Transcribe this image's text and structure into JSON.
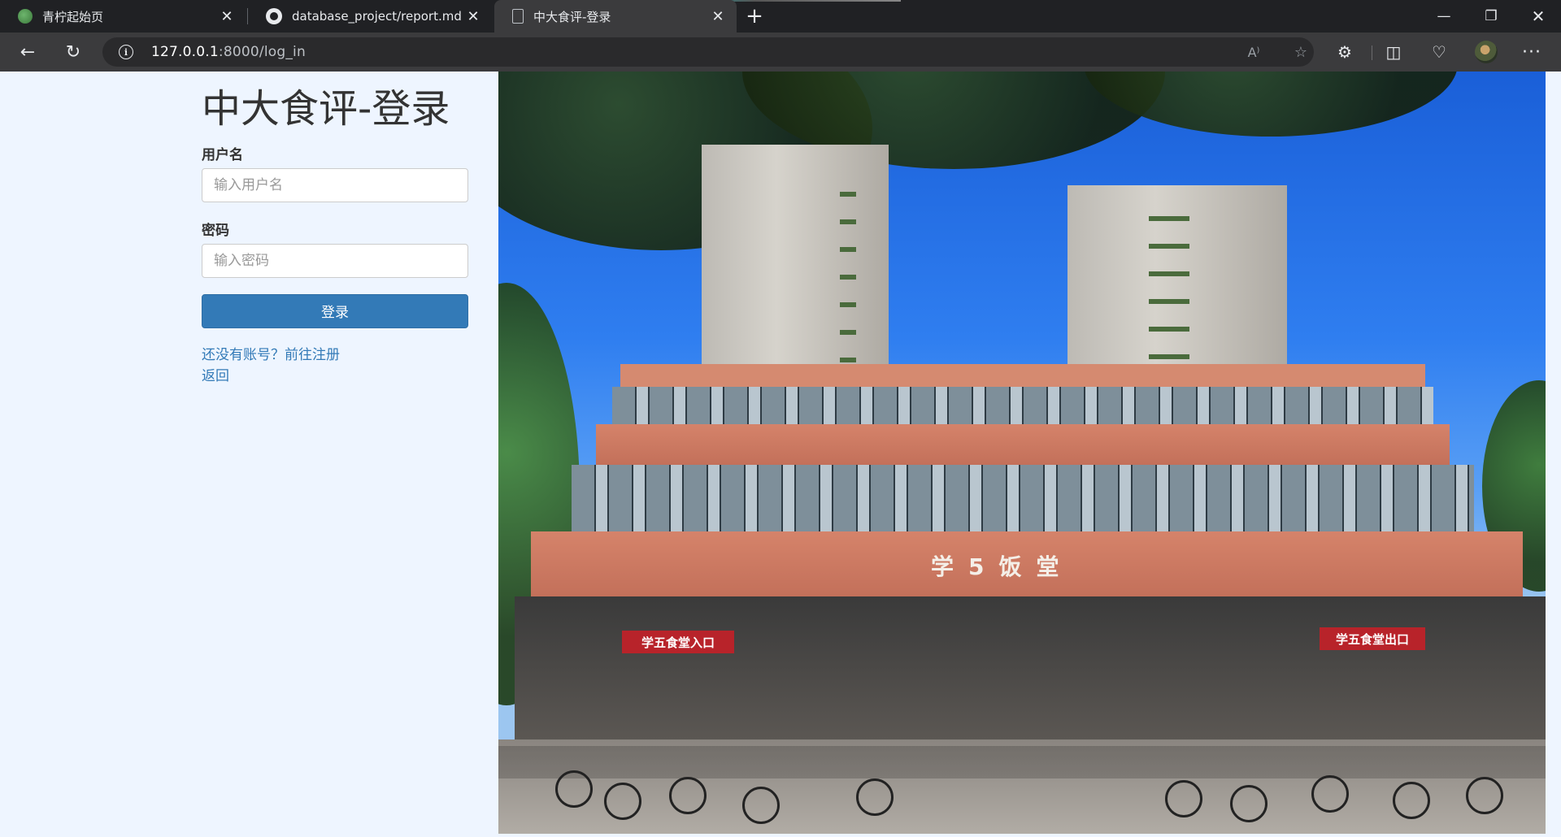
{
  "browser": {
    "tabs": [
      {
        "title": "青柠起始页",
        "icon": "leaf-icon"
      },
      {
        "title": "database_project/report.md at m",
        "icon": "github-icon"
      },
      {
        "title": "中大食评-登录",
        "icon": "document-icon",
        "active": true
      }
    ],
    "close_glyph": "✕",
    "new_tab_glyph": "+",
    "window_controls": {
      "minimize": "—",
      "maximize": "❐",
      "close": "✕"
    },
    "back_glyph": "←",
    "reload_glyph": "↻",
    "info_glyph": "i",
    "url_host": "127.0.0.1",
    "url_rest": ":8000/log_in",
    "read_aloud_glyph": "A⁾",
    "star_glyph": "☆",
    "extensions_glyph": "⚙",
    "split_glyph": "◫",
    "performance_glyph": "♡",
    "more_glyph": "···"
  },
  "login": {
    "title": "中大食评-登录",
    "username_label": "用户名",
    "username_placeholder": "输入用户名",
    "password_label": "密码",
    "password_placeholder": "输入密码",
    "submit_label": "登录",
    "register_link": "还没有账号？前往注册",
    "back_link": "返回"
  },
  "photo": {
    "building_sign": "学5饭堂",
    "entrance_sign": "学五食堂入口",
    "exit_sign": "学五食堂出口"
  },
  "colors": {
    "page_bg": "#eef5ff",
    "primary": "#337ab7",
    "chrome_dark": "#202124",
    "chrome_toolbar": "#3b3b3d"
  }
}
